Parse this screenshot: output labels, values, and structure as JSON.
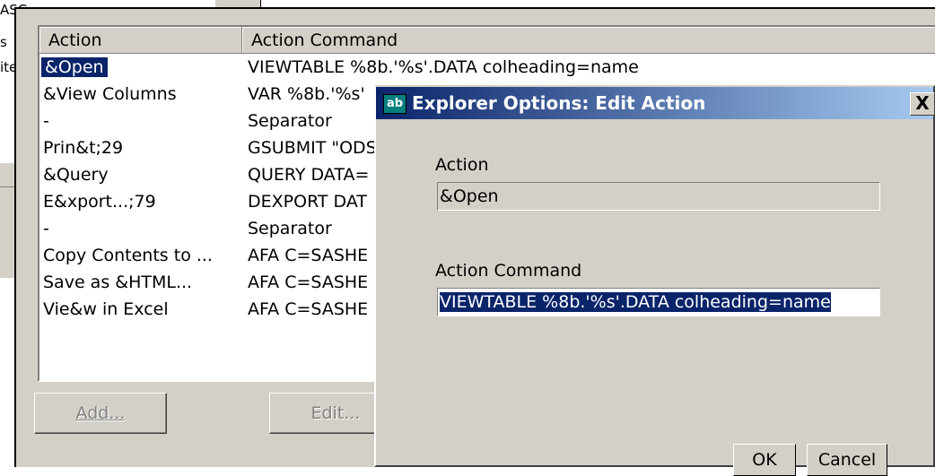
{
  "background_window": {
    "text_lines": [
      "ASC...",
      "s",
      "ite"
    ]
  },
  "main_dialog": {
    "columns": [
      "Action",
      "Action Command"
    ],
    "rows": [
      {
        "action": "&Open",
        "command": "VIEWTABLE %8b.'%s'.DATA colheading=name",
        "selected": true
      },
      {
        "action": "&View Columns",
        "command": "VAR %8b.'%s'"
      },
      {
        "action": "-",
        "command": "Separator"
      },
      {
        "action": "Prin&t;29",
        "command": "GSUBMIT \"ODS"
      },
      {
        "action": "&Query",
        "command": "QUERY DATA="
      },
      {
        "action": "E&xport...;79",
        "command": "DEXPORT DAT"
      },
      {
        "action": "-",
        "command": "Separator"
      },
      {
        "action": "Copy Contents to ...",
        "command": "AFA C=SASHE"
      },
      {
        "action": "Save as &HTML...",
        "command": "AFA C=SASHE"
      },
      {
        "action": "Vie&w in Excel",
        "command": "AFA C=SASHE"
      }
    ],
    "buttons": {
      "add": "Add...",
      "edit": "Edit..."
    }
  },
  "edit_dialog": {
    "title": "Explorer Options: Edit Action",
    "icon_text": "ab",
    "close_label": "X",
    "action_label": "Action",
    "action_value": "&Open",
    "command_label": "Action Command",
    "command_value": "VIEWTABLE %8b.'%s'.DATA colheading=name",
    "ok_label": "OK",
    "cancel_label": "Cancel"
  }
}
